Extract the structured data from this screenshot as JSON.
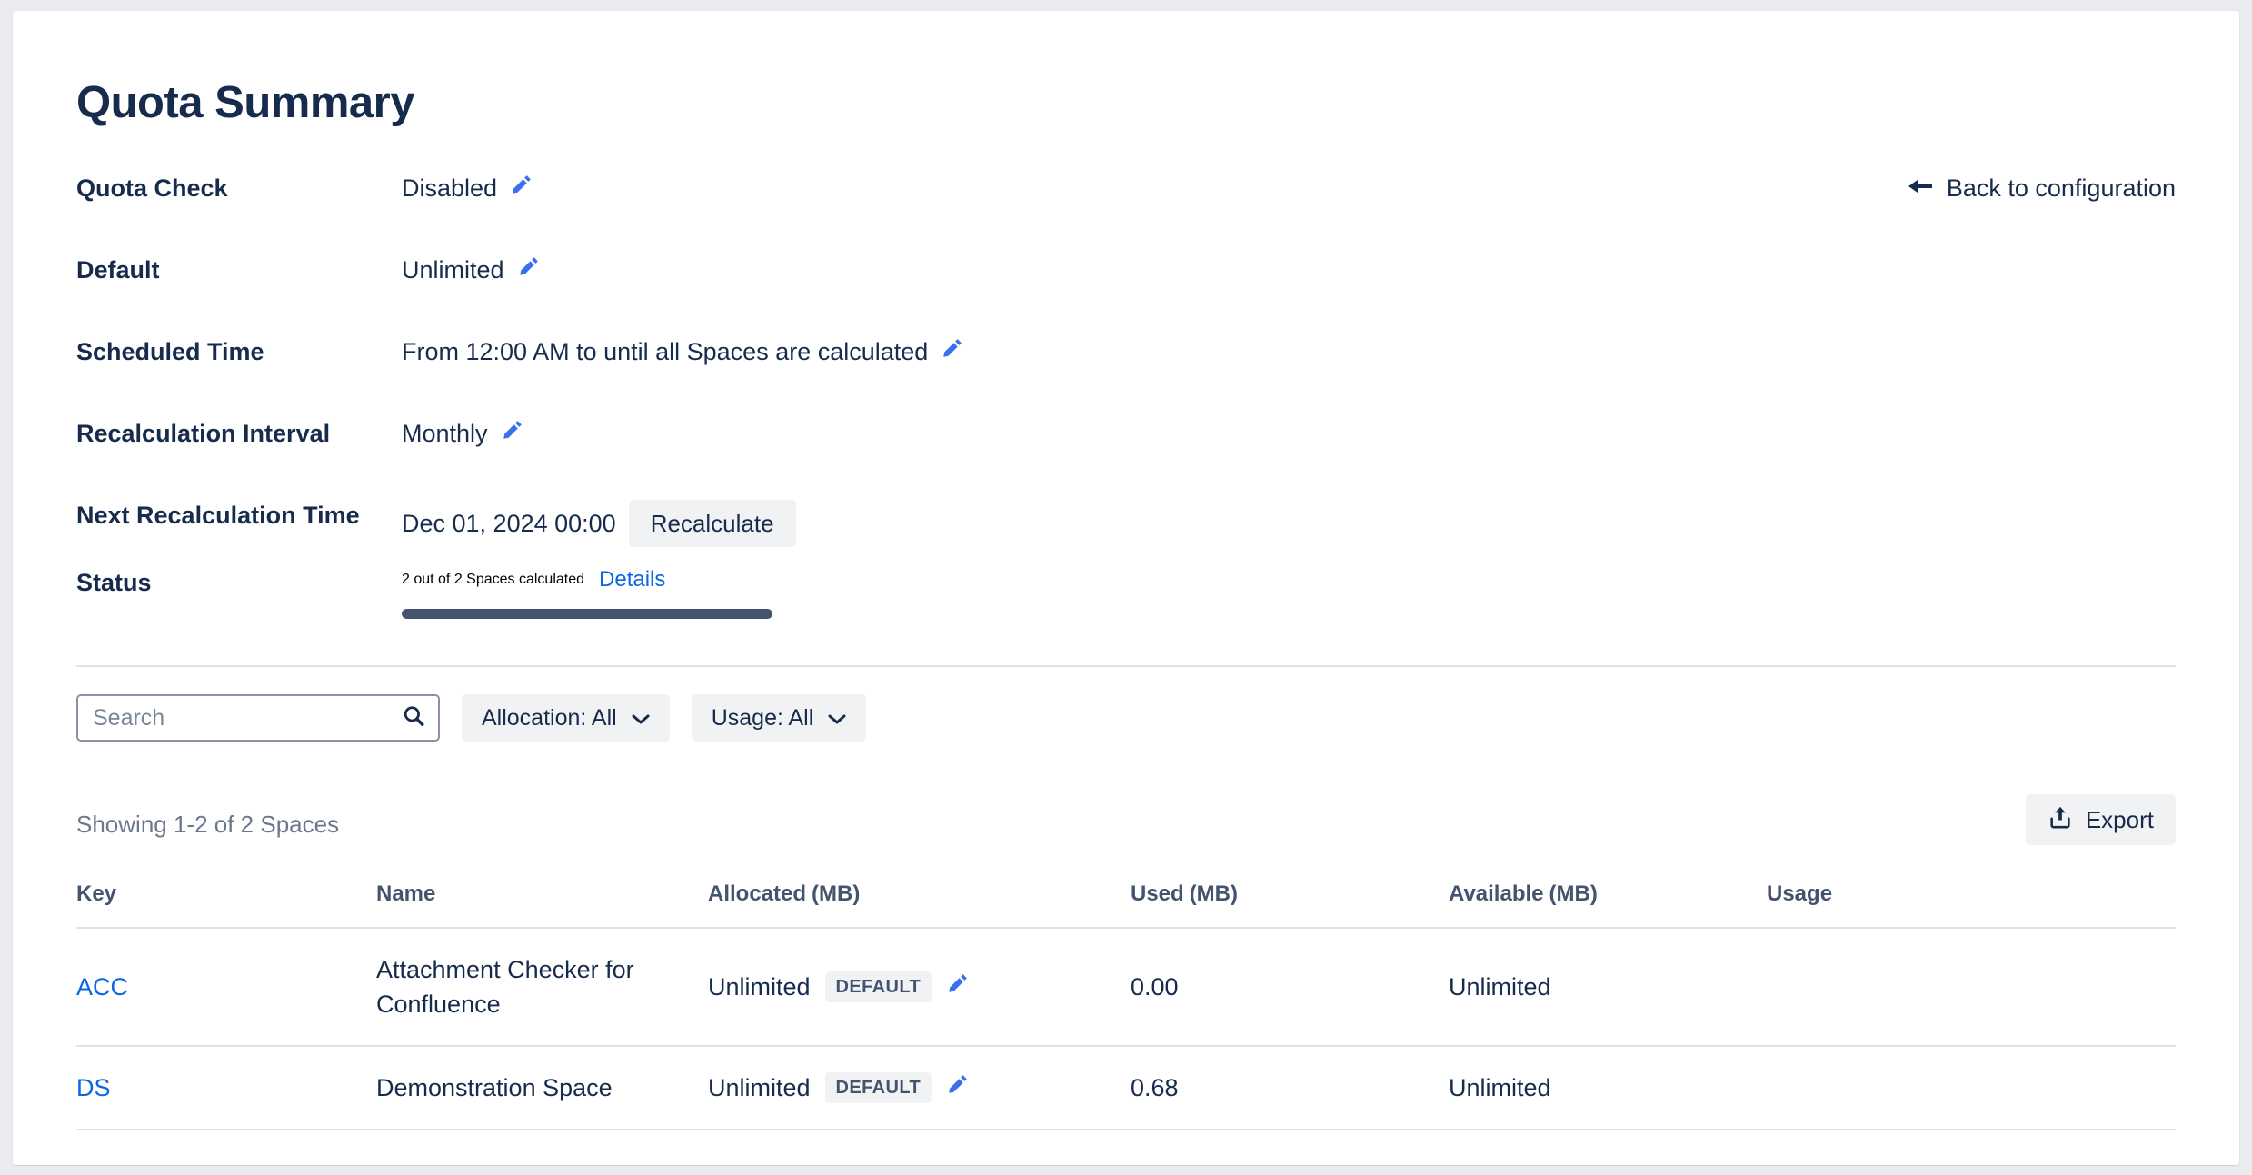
{
  "page": {
    "title": "Quota Summary"
  },
  "back_link": {
    "label": "Back to configuration",
    "icon": "long-arrow-left-icon"
  },
  "summary": {
    "rows": [
      {
        "label": "Quota Check",
        "value": "Disabled"
      },
      {
        "label": "Default",
        "value": "Unlimited"
      },
      {
        "label": "Scheduled Time",
        "value": "From 12:00 AM to until all Spaces are calculated"
      },
      {
        "label": "Recalculation Interval",
        "value": "Monthly"
      }
    ],
    "next_recalculation": {
      "label": "Next Recalculation Time",
      "value": "Dec 01, 2024 00:00",
      "button_label": "Recalculate"
    },
    "status": {
      "label": "Status",
      "value": "2 out of 2 Spaces calculated",
      "details_label": "Details",
      "progress_percent": 100
    }
  },
  "controls": {
    "search_placeholder": "Search",
    "search_value": "",
    "search_icon": "search-icon",
    "allocation_filter": "Allocation: All",
    "usage_filter": "Usage: All"
  },
  "list_header": {
    "showing": "Showing 1-2 of 2 Spaces",
    "export_label": "Export",
    "export_icon": "upload-icon"
  },
  "table": {
    "columns": [
      {
        "label": "Key",
        "unit": ""
      },
      {
        "label": "Name",
        "unit": ""
      },
      {
        "label": "Allocated",
        "unit": "(MB)"
      },
      {
        "label": "Used",
        "unit": "(MB)"
      },
      {
        "label": "Available",
        "unit": "(MB)"
      },
      {
        "label": "Usage",
        "unit": ""
      }
    ],
    "rows": [
      {
        "key": "ACC",
        "name": "Attachment Checker for Confluence",
        "allocated": "Unlimited",
        "allocated_badge": "DEFAULT",
        "used": "0.00",
        "available": "Unlimited",
        "usage": ""
      },
      {
        "key": "DS",
        "name": "Demonstration Space",
        "allocated": "Unlimited",
        "allocated_badge": "DEFAULT",
        "used": "0.68",
        "available": "Unlimited",
        "usage": ""
      }
    ]
  },
  "colors": {
    "text_primary": "#172b4d",
    "text_muted": "#6b778c",
    "link": "#0c66e4",
    "accent_pencil": "#3a6ff0",
    "progress": "#44546f",
    "surface_subtle": "#f1f2f4",
    "border": "#dfe1e6",
    "page_background": "#e9ebef"
  }
}
